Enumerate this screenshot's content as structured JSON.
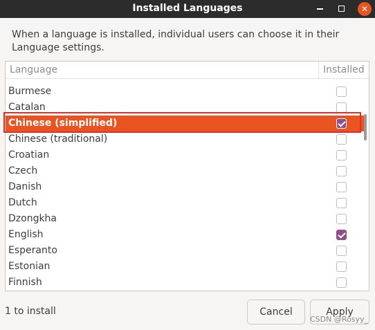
{
  "window": {
    "title": "Installed Languages"
  },
  "description": "When a language is installed, individual users can choose it in their Language settings.",
  "table": {
    "columns": [
      "Language",
      "Installed"
    ],
    "rows": [
      {
        "name": "Burmese",
        "installed": false
      },
      {
        "name": "Catalan",
        "installed": false
      },
      {
        "name": "Chinese (simplified)",
        "installed": true,
        "selected": true
      },
      {
        "name": "Chinese (traditional)",
        "installed": false
      },
      {
        "name": "Croatian",
        "installed": false
      },
      {
        "name": "Czech",
        "installed": false
      },
      {
        "name": "Danish",
        "installed": false
      },
      {
        "name": "Dutch",
        "installed": false
      },
      {
        "name": "Dzongkha",
        "installed": false
      },
      {
        "name": "English",
        "installed": true
      },
      {
        "name": "Esperanto",
        "installed": false
      },
      {
        "name": "Estonian",
        "installed": false
      },
      {
        "name": "Finnish",
        "installed": false
      }
    ]
  },
  "footer": {
    "status": "1 to install",
    "cancel_label": "Cancel",
    "apply_label": "Apply"
  },
  "watermark": "CSDN @Rosyy_",
  "colors": {
    "titlebar": "#2c2c2c",
    "selection": "#e95420",
    "checkbox_checked": "#924d8b",
    "annotation_box": "#d9312b"
  }
}
